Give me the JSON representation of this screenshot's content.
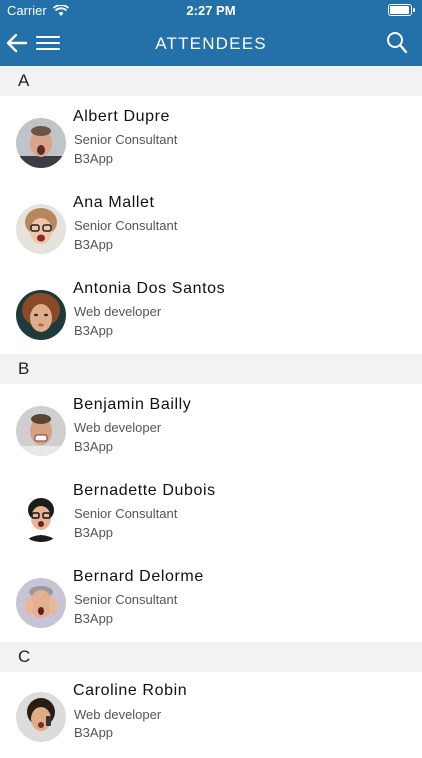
{
  "status_bar": {
    "carrier": "Carrier",
    "time": "2:27 PM",
    "wifi_icon": "wifi-icon",
    "battery_icon": "battery-icon"
  },
  "header": {
    "title": "ATTENDEES",
    "back_icon": "arrow-left-icon",
    "menu_icon": "menu-icon",
    "search_icon": "search-icon",
    "color": "#2470a8"
  },
  "sections": [
    {
      "letter": "A",
      "attendees": [
        {
          "name": "Albert Dupre",
          "role": "Senior Consultant",
          "company": "B3App"
        },
        {
          "name": "Ana Mallet",
          "role": "Senior Consultant",
          "company": "B3App"
        },
        {
          "name": "Antonia Dos Santos",
          "role": "Web developer",
          "company": "B3App"
        }
      ]
    },
    {
      "letter": "B",
      "attendees": [
        {
          "name": "Benjamin Bailly",
          "role": "Web developer",
          "company": "B3App"
        },
        {
          "name": "Bernadette Dubois",
          "role": "Senior Consultant",
          "company": "B3App"
        },
        {
          "name": "Bernard Delorme",
          "role": "Senior Consultant",
          "company": "B3App"
        }
      ]
    },
    {
      "letter": "C",
      "attendees": [
        {
          "name": "Caroline Robin",
          "role": "Web developer",
          "company": "B3App"
        }
      ]
    }
  ]
}
